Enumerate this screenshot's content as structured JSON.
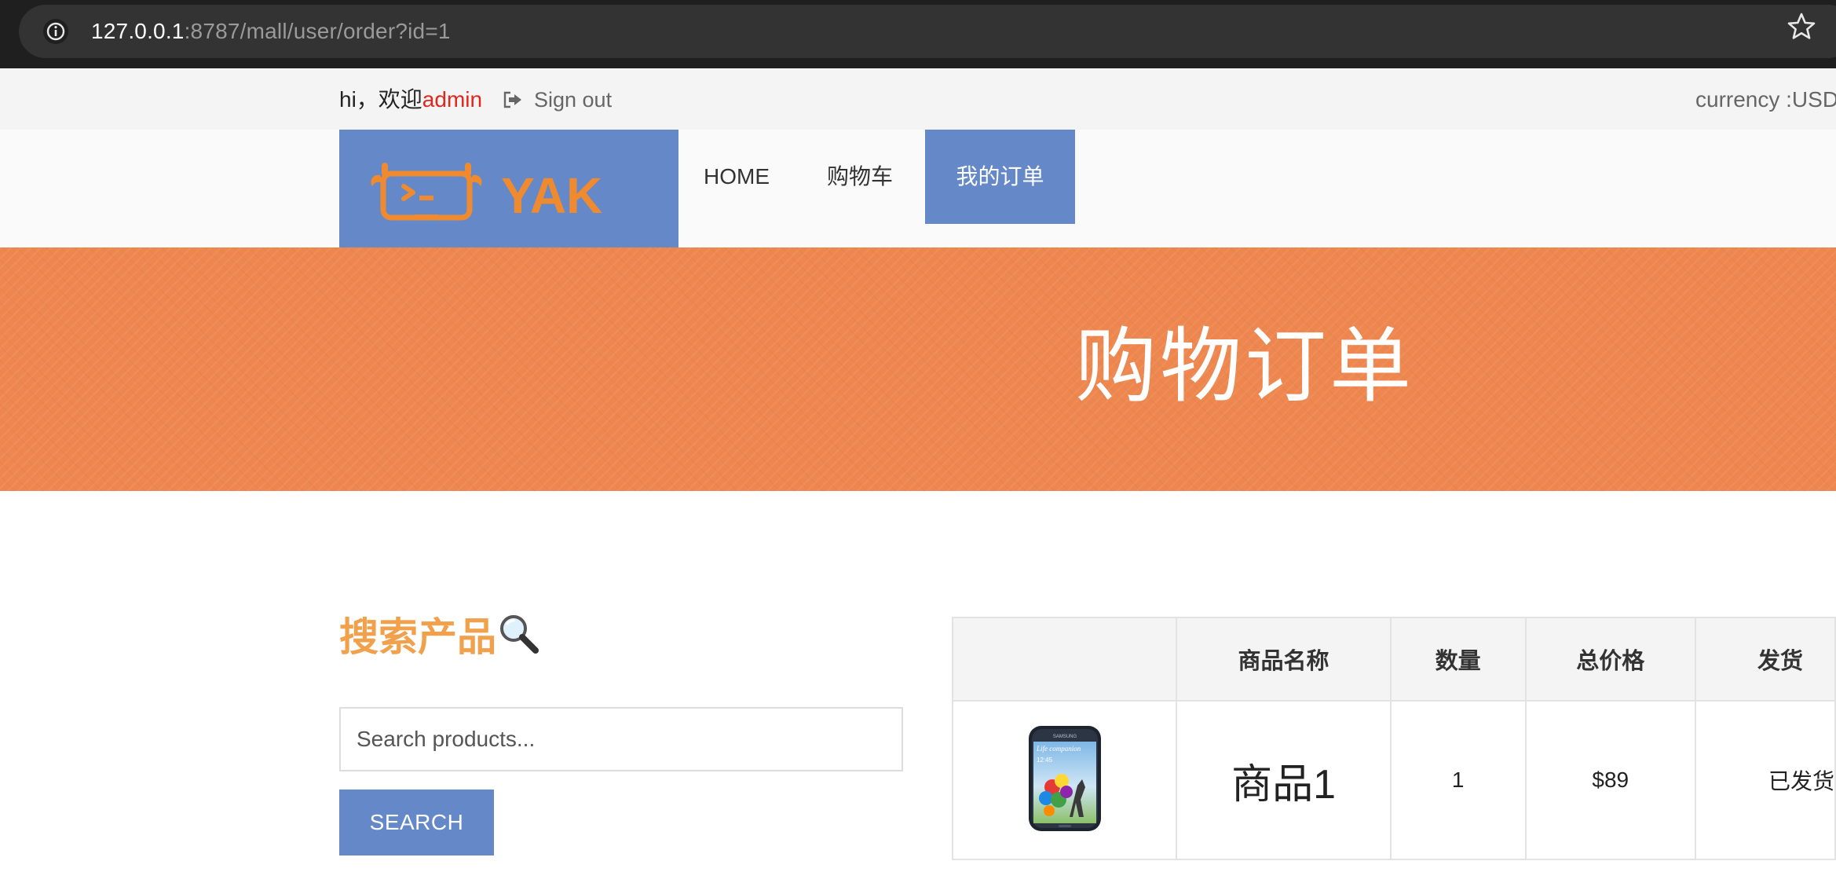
{
  "browser": {
    "url_host": "127.0.0.1",
    "url_rest": ":8787/mall/user/order?id=1",
    "info_icon": "info-icon",
    "star_icon": "bookmark-star-icon"
  },
  "topbar": {
    "greeting_prefix": "hi，欢迎",
    "username": "admin",
    "signout_label": "Sign out",
    "currency_label": "currency :USD"
  },
  "nav": {
    "logo_text": "YAK",
    "items": [
      {
        "label": "HOME"
      },
      {
        "label": "购物车"
      },
      {
        "label": "我的订单",
        "active": true
      }
    ]
  },
  "banner": {
    "title": "购物订单"
  },
  "sidebar": {
    "search_title": "搜索产品",
    "search_icon": "magnifier-icon",
    "search_placeholder": "Search products...",
    "search_button": "SEARCH"
  },
  "orders": {
    "columns": [
      "",
      "商品名称",
      "数量",
      "总价格",
      "发货"
    ],
    "rows": [
      {
        "image": "samsung-phone-thumbnail",
        "phone_brand_text": "SAMSUNG",
        "phone_screen_text": "Life companion",
        "phone_time_text": "12:45",
        "name": "商品1",
        "quantity": "1",
        "total": "$89",
        "status": "已发货"
      }
    ]
  },
  "colors": {
    "brand_blue": "#6589c8",
    "banner_orange": "#ee874f",
    "search_title_orange": "#f1a04c",
    "accent_red": "#e1261c",
    "logo_orange": "#f08a2e"
  }
}
